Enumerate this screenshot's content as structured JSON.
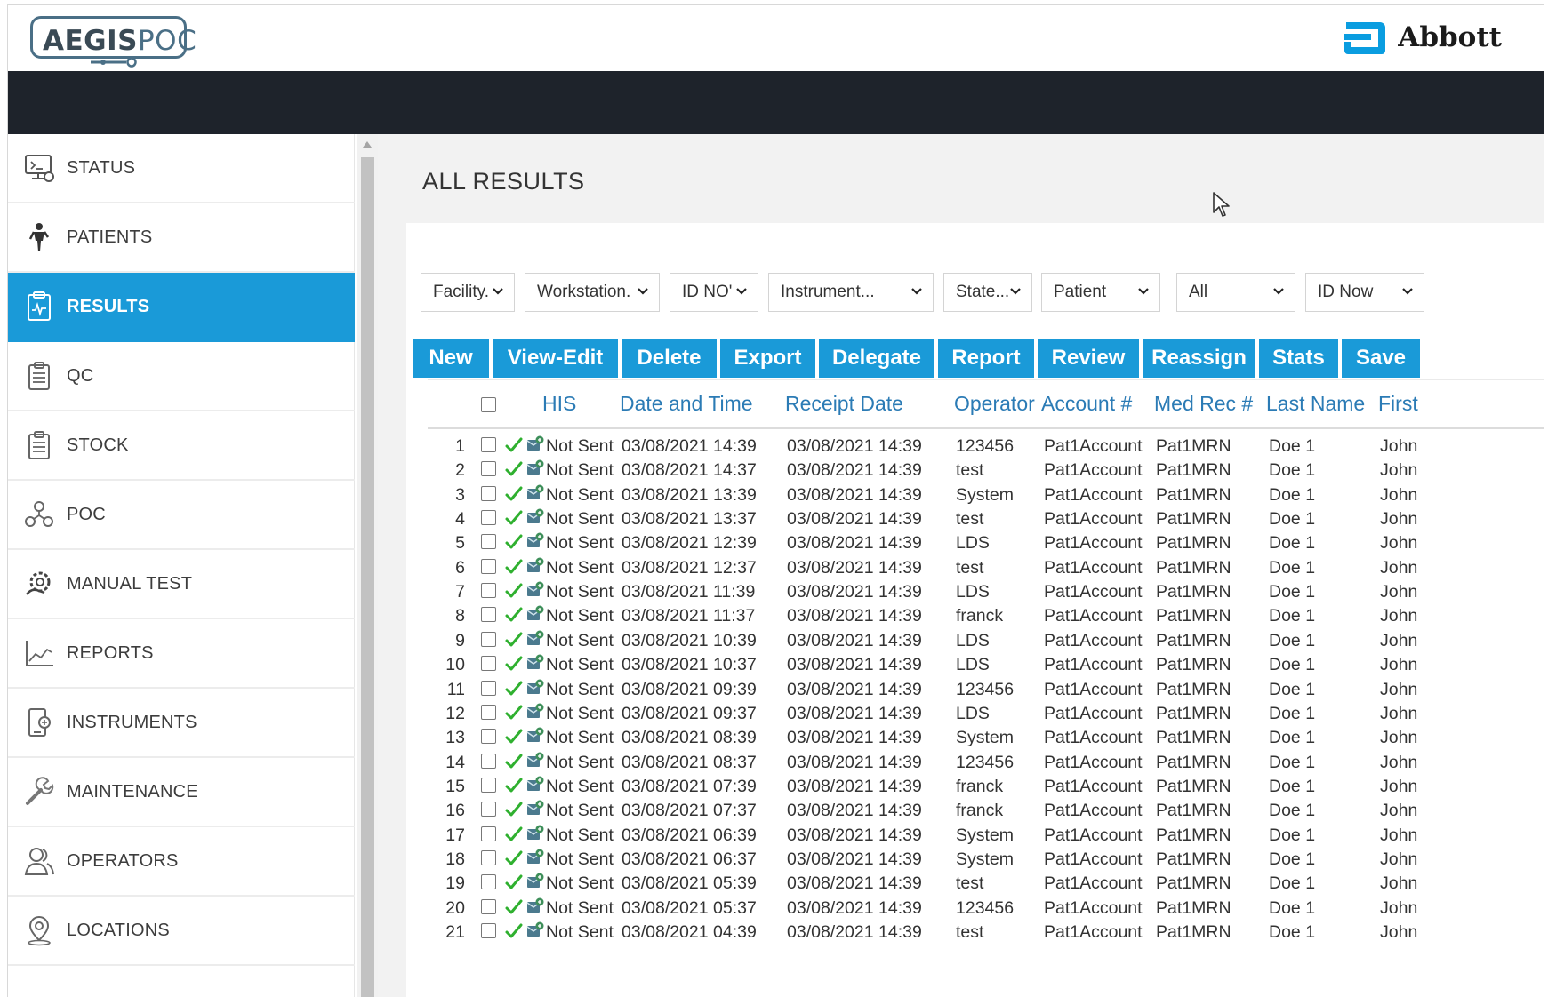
{
  "header": {
    "logo_bold": "AEGIS",
    "logo_light": "POC",
    "brand": "Abbott"
  },
  "sidebar": {
    "items": [
      {
        "label": "STATUS",
        "icon": "monitor-settings-icon"
      },
      {
        "label": "PATIENTS",
        "icon": "person-icon"
      },
      {
        "label": "RESULTS",
        "icon": "clipboard-chart-icon",
        "active": true
      },
      {
        "label": "QC",
        "icon": "clipboard-list-icon"
      },
      {
        "label": "STOCK",
        "icon": "clipboard-list-icon"
      },
      {
        "label": "POC",
        "icon": "network-icon"
      },
      {
        "label": "MANUAL TEST",
        "icon": "gear-hand-icon"
      },
      {
        "label": "REPORTS",
        "icon": "line-chart-icon"
      },
      {
        "label": "INSTRUMENTS",
        "icon": "device-icon"
      },
      {
        "label": "MAINTENANCE",
        "icon": "wrench-icon"
      },
      {
        "label": "OPERATORS",
        "icon": "users-icon"
      },
      {
        "label": "LOCATIONS",
        "icon": "location-pin-icon"
      }
    ]
  },
  "main": {
    "title": "ALL RESULTS"
  },
  "filters": {
    "facility": "Facility.",
    "workstation": "Workstation.",
    "id_no": "ID NO'",
    "instrument": "Instrument...",
    "state": "State...",
    "patient": "Patient",
    "all": "All",
    "id_now": "ID Now"
  },
  "toolbar": {
    "new": "New",
    "view_edit": "View-Edit",
    "delete": "Delete",
    "export": "Export",
    "delegate": "Delegate",
    "report": "Report",
    "review": "Review",
    "reassign": "Reassign",
    "stats": "Stats",
    "save": "Save"
  },
  "table": {
    "columns": {
      "his": "HIS",
      "date_time": "Date and Time",
      "receipt_date": "Receipt Date",
      "operator": "Operator",
      "account": "Account #",
      "med_rec": "Med Rec #",
      "last_name": "Last Name",
      "first": "First"
    },
    "rows": [
      {
        "n": "1",
        "his": "Not Sent",
        "dt": "03/08/2021 14:39",
        "rd": "03/08/2021 14:39",
        "op": "123456",
        "acct": "Pat1Account",
        "mrn": "Pat1MRN",
        "last": "Doe 1",
        "first": "John"
      },
      {
        "n": "2",
        "his": "Not Sent",
        "dt": "03/08/2021 14:37",
        "rd": "03/08/2021 14:39",
        "op": "test",
        "acct": "Pat1Account",
        "mrn": "Pat1MRN",
        "last": "Doe 1",
        "first": "John"
      },
      {
        "n": "3",
        "his": "Not Sent",
        "dt": "03/08/2021 13:39",
        "rd": "03/08/2021 14:39",
        "op": "System",
        "acct": "Pat1Account",
        "mrn": "Pat1MRN",
        "last": "Doe 1",
        "first": "John"
      },
      {
        "n": "4",
        "his": "Not Sent",
        "dt": "03/08/2021 13:37",
        "rd": "03/08/2021 14:39",
        "op": "test",
        "acct": "Pat1Account",
        "mrn": "Pat1MRN",
        "last": "Doe 1",
        "first": "John"
      },
      {
        "n": "5",
        "his": "Not Sent",
        "dt": "03/08/2021 12:39",
        "rd": "03/08/2021 14:39",
        "op": "LDS",
        "acct": "Pat1Account",
        "mrn": "Pat1MRN",
        "last": "Doe 1",
        "first": "John"
      },
      {
        "n": "6",
        "his": "Not Sent",
        "dt": "03/08/2021 12:37",
        "rd": "03/08/2021 14:39",
        "op": "test",
        "acct": "Pat1Account",
        "mrn": "Pat1MRN",
        "last": "Doe 1",
        "first": "John"
      },
      {
        "n": "7",
        "his": "Not Sent",
        "dt": "03/08/2021 11:39",
        "rd": "03/08/2021 14:39",
        "op": "LDS",
        "acct": "Pat1Account",
        "mrn": "Pat1MRN",
        "last": "Doe 1",
        "first": "John"
      },
      {
        "n": "8",
        "his": "Not Sent",
        "dt": "03/08/2021 11:37",
        "rd": "03/08/2021 14:39",
        "op": "franck",
        "acct": "Pat1Account",
        "mrn": "Pat1MRN",
        "last": "Doe 1",
        "first": "John"
      },
      {
        "n": "9",
        "his": "Not Sent",
        "dt": "03/08/2021 10:39",
        "rd": "03/08/2021 14:39",
        "op": "LDS",
        "acct": "Pat1Account",
        "mrn": "Pat1MRN",
        "last": "Doe 1",
        "first": "John"
      },
      {
        "n": "10",
        "his": "Not Sent",
        "dt": "03/08/2021 10:37",
        "rd": "03/08/2021 14:39",
        "op": "LDS",
        "acct": "Pat1Account",
        "mrn": "Pat1MRN",
        "last": "Doe 1",
        "first": "John"
      },
      {
        "n": "11",
        "his": "Not Sent",
        "dt": "03/08/2021 09:39",
        "rd": "03/08/2021 14:39",
        "op": "123456",
        "acct": "Pat1Account",
        "mrn": "Pat1MRN",
        "last": "Doe 1",
        "first": "John"
      },
      {
        "n": "12",
        "his": "Not Sent",
        "dt": "03/08/2021 09:37",
        "rd": "03/08/2021 14:39",
        "op": "LDS",
        "acct": "Pat1Account",
        "mrn": "Pat1MRN",
        "last": "Doe 1",
        "first": "John"
      },
      {
        "n": "13",
        "his": "Not Sent",
        "dt": "03/08/2021 08:39",
        "rd": "03/08/2021 14:39",
        "op": "System",
        "acct": "Pat1Account",
        "mrn": "Pat1MRN",
        "last": "Doe 1",
        "first": "John"
      },
      {
        "n": "14",
        "his": "Not Sent",
        "dt": "03/08/2021 08:37",
        "rd": "03/08/2021 14:39",
        "op": "123456",
        "acct": "Pat1Account",
        "mrn": "Pat1MRN",
        "last": "Doe 1",
        "first": "John"
      },
      {
        "n": "15",
        "his": "Not Sent",
        "dt": "03/08/2021 07:39",
        "rd": "03/08/2021 14:39",
        "op": "franck",
        "acct": "Pat1Account",
        "mrn": "Pat1MRN",
        "last": "Doe 1",
        "first": "John"
      },
      {
        "n": "16",
        "his": "Not Sent",
        "dt": "03/08/2021 07:37",
        "rd": "03/08/2021 14:39",
        "op": "franck",
        "acct": "Pat1Account",
        "mrn": "Pat1MRN",
        "last": "Doe 1",
        "first": "John"
      },
      {
        "n": "17",
        "his": "Not Sent",
        "dt": "03/08/2021 06:39",
        "rd": "03/08/2021 14:39",
        "op": "System",
        "acct": "Pat1Account",
        "mrn": "Pat1MRN",
        "last": "Doe 1",
        "first": "John"
      },
      {
        "n": "18",
        "his": "Not Sent",
        "dt": "03/08/2021 06:37",
        "rd": "03/08/2021 14:39",
        "op": "System",
        "acct": "Pat1Account",
        "mrn": "Pat1MRN",
        "last": "Doe 1",
        "first": "John"
      },
      {
        "n": "19",
        "his": "Not Sent",
        "dt": "03/08/2021 05:39",
        "rd": "03/08/2021 14:39",
        "op": "test",
        "acct": "Pat1Account",
        "mrn": "Pat1MRN",
        "last": "Doe 1",
        "first": "John"
      },
      {
        "n": "20",
        "his": "Not Sent",
        "dt": "03/08/2021 05:37",
        "rd": "03/08/2021 14:39",
        "op": "123456",
        "acct": "Pat1Account",
        "mrn": "Pat1MRN",
        "last": "Doe 1",
        "first": "John"
      },
      {
        "n": "21",
        "his": "Not Sent",
        "dt": "03/08/2021 04:39",
        "rd": "03/08/2021 14:39",
        "op": "test",
        "acct": "Pat1Account",
        "mrn": "Pat1MRN",
        "last": "Doe 1",
        "first": "John"
      }
    ]
  },
  "colors": {
    "accent": "#1a9ad8",
    "header_dark": "#1e232b",
    "link": "#2b7bb5",
    "check_green": "#2fb02f"
  }
}
